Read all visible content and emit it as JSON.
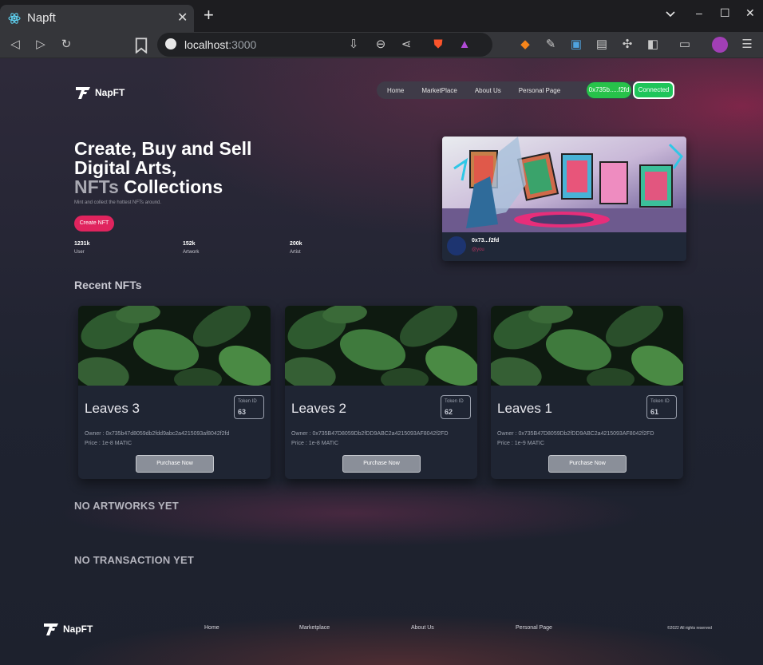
{
  "browser": {
    "tab_title": "Napft",
    "tab_close": "✕",
    "new_tab": "+",
    "url_host": "localhost",
    "url_port": ":3000",
    "controls": {
      "minimize": "–",
      "maximize": "☐",
      "close": "✕"
    }
  },
  "brand": {
    "name": "NapFT"
  },
  "nav": {
    "items": [
      "Home",
      "MarketPlace",
      "About Us",
      "Personal Page"
    ],
    "wallet": "0x735b.....f2fd",
    "status": "Connected"
  },
  "hero": {
    "line1": "Create, Buy and Sell",
    "line2": "Digital Arts,",
    "line3_dim": "NFTs",
    "line3_rest": " Collections",
    "subtitle": "Mint and collect the hottest NFTs around.",
    "cta": "Create NFT",
    "stats": [
      {
        "value": "1231k",
        "label": "User"
      },
      {
        "value": "152k",
        "label": "Artwork"
      },
      {
        "value": "200k",
        "label": "Artist"
      }
    ]
  },
  "featured": {
    "owner": "0x73...f2fd",
    "handle": "@you"
  },
  "recent": {
    "title": "Recent NFTs",
    "cards": [
      {
        "name": "Leaves 3",
        "token_label": "Token ID",
        "token_id": "63",
        "owner": "Owner : 0x735b47d8059db2fdd9abc2a4215093af8042f2fd",
        "price": "Price : 1e-8 MATIC",
        "button": "Purchase Now"
      },
      {
        "name": "Leaves 2",
        "token_label": "Token ID",
        "token_id": "62",
        "owner": "Owner : 0x735B47D8059Db2fDD9ABC2a4215093AF8042f2FD",
        "price": "Price : 1e-8 MATIC",
        "button": "Purchase Now"
      },
      {
        "name": "Leaves 1",
        "token_label": "Token ID",
        "token_id": "61",
        "owner": "Owner : 0x735B47D8059Db2fDD9ABC2a4215093AF8042f2FD",
        "price": "Price : 1e-9 MATIC",
        "button": "Purchase Now"
      }
    ]
  },
  "artworks_empty": "NO ARTWORKS YET",
  "transactions_empty": "NO TRANSACTION YET",
  "footer": {
    "links": [
      "Home",
      "Marketplace",
      "About Us",
      "Personal Page"
    ],
    "copyright": "©2022 All rights reserved"
  },
  "colors": {
    "accent_pink": "#e0245e",
    "connected_green": "#1ec55a",
    "page_bg": "#1d212d"
  }
}
